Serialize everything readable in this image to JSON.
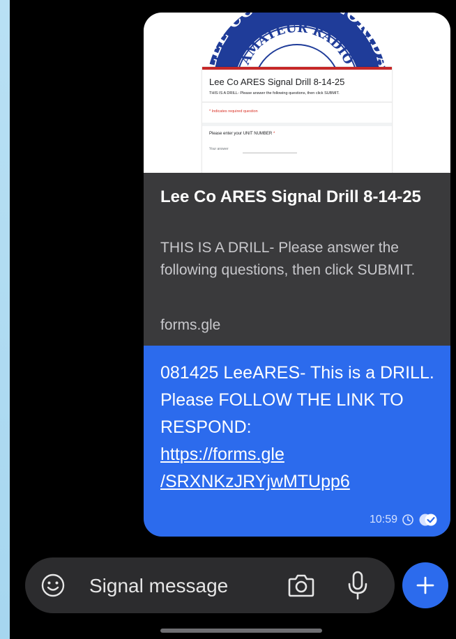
{
  "preview": {
    "logo_line1": "LEE COUNTY, FLORIDA",
    "logo_line2": "AMATEUR RADIO",
    "form_title": "Lee Co ARES Signal Drill 8-14-25",
    "form_description": "THIS IS A DRILL- Please answer the following questions, then click SUBMIT.",
    "required_note": "* Indicates required question",
    "question_label": "Please enter your UNIT NUMBER",
    "question_required_mark": "*",
    "answer_placeholder": "Your answer"
  },
  "link": {
    "title": "Lee Co ARES Signal Drill 8-14-25",
    "description": "THIS IS A DRILL- Please answer the following questions, then click SUBMIT.",
    "domain": "forms.gle"
  },
  "message": {
    "text": "081425 LeeARES- This is a DRILL. Please FOLLOW THE LINK TO RESPOND:",
    "link_line1": "https://forms.gle",
    "link_line2": "/SRXNKzJRYjwMTUpp6",
    "time": "10:59"
  },
  "composer": {
    "placeholder": "Signal message"
  },
  "icons": {
    "emoji": "emoji-icon",
    "camera": "camera-icon",
    "mic": "microphone-icon",
    "send": "plus-icon",
    "timer": "disappearing-timer-icon",
    "delivered": "read-receipt-icon"
  },
  "colors": {
    "accent_blue": "#2c6bed",
    "bubble_gray": "#3a3a3c",
    "background": "#000000",
    "logo_red": "#c62828",
    "logo_blue": "#1f3c99"
  }
}
